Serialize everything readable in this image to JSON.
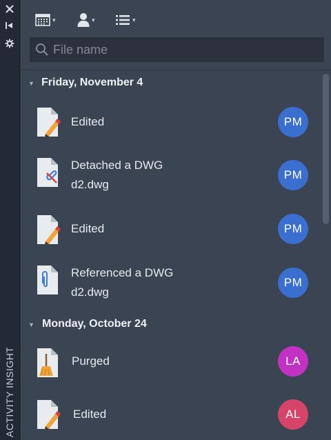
{
  "strip": {
    "label": "ACTIVITY INSIGHTS",
    "icons": [
      "close-icon",
      "pin-icon",
      "settings-icon"
    ]
  },
  "toolbar": {
    "buttons": [
      {
        "icon": "calendar-icon",
        "caret": "▾"
      },
      {
        "icon": "user-icon",
        "caret": "▾"
      },
      {
        "icon": "list-icon",
        "caret": "▾"
      }
    ]
  },
  "search": {
    "placeholder": "File name",
    "value": ""
  },
  "groups": [
    {
      "title": "Friday, November 4",
      "items": [
        {
          "action": "Edited",
          "file": "",
          "icon": "edit-file-icon",
          "user": "PM",
          "color": "#3a6fd0"
        },
        {
          "action": "Detached a DWG",
          "file": "d2.dwg",
          "icon": "detach-file-icon",
          "user": "PM",
          "color": "#3a6fd0"
        },
        {
          "action": "Edited",
          "file": "",
          "icon": "edit-file-icon",
          "user": "PM",
          "color": "#3a6fd0"
        },
        {
          "action": "Referenced a DWG",
          "file": "d2.dwg",
          "icon": "reference-file-icon",
          "user": "PM",
          "color": "#3a6fd0"
        }
      ]
    },
    {
      "title": "Monday, October 24",
      "items": [
        {
          "action": "Purged",
          "file": "",
          "icon": "purge-file-icon",
          "user": "LA",
          "color": "#c232c2"
        },
        {
          "action": "Edited",
          "file": "",
          "icon": "edit-file-icon",
          "user": "AL",
          "color": "#d6446a"
        }
      ]
    }
  ],
  "colors": {
    "background": "#3b4453",
    "strip": "#232a35",
    "search": "#2b323e",
    "text": "#e6e9ee"
  }
}
